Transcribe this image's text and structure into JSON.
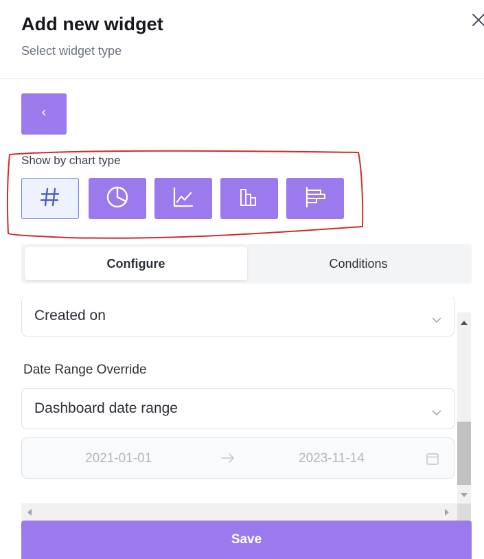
{
  "header": {
    "title": "Add new widget",
    "subtitle": "Select widget type",
    "close_icon": "close-icon"
  },
  "back_button": {
    "icon": "chevron-left-icon"
  },
  "chart_type": {
    "label": "Show by chart type",
    "options": [
      {
        "icon": "hash-icon",
        "active": true
      },
      {
        "icon": "pie-chart-icon",
        "active": false
      },
      {
        "icon": "line-chart-icon",
        "active": false
      },
      {
        "icon": "bar-chart-icon",
        "active": false
      },
      {
        "icon": "horizontal-bar-chart-icon",
        "active": false
      }
    ]
  },
  "tabs": {
    "configure": "Configure",
    "conditions": "Conditions",
    "active": "configure"
  },
  "form": {
    "date_field_value": "Created on",
    "date_range_override_label": "Date Range Override",
    "date_range_override_value": "Dashboard date range",
    "range_start": "2021-01-01",
    "range_end": "2023-11-14"
  },
  "save_label": "Save",
  "colors": {
    "accent": "#9b7aee",
    "active_chart_border": "#6d7fe8",
    "annotation": "#d42a2a"
  }
}
